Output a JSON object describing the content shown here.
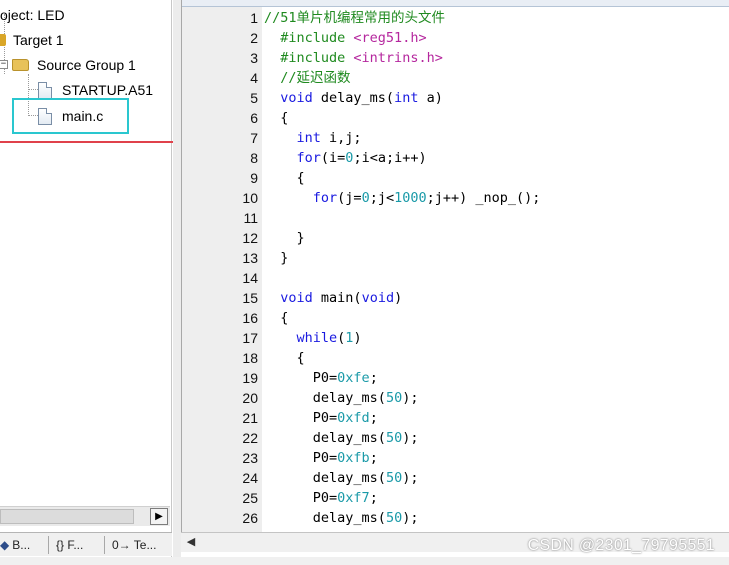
{
  "project_tree": {
    "project_label": "Project: LED",
    "target_label": "Target 1",
    "group_label": "Source Group 1",
    "files": [
      "STARTUP.A51",
      "main.c"
    ]
  },
  "left_tabs": [
    {
      "icon": "book-icon",
      "label": "B..."
    },
    {
      "icon": "braces-icon",
      "label": "{} F..."
    },
    {
      "icon": "template-icon",
      "label": "0→ Te..."
    }
  ],
  "scroll_arrows": {
    "right": "▶",
    "left": "◀"
  },
  "editor": {
    "lines": [
      {
        "n": "1",
        "indent": "",
        "tokens": [
          [
            "cm",
            "//51单片机编程常用的头文件"
          ]
        ]
      },
      {
        "n": "2",
        "indent": "  ",
        "tokens": [
          [
            "pp",
            "#include "
          ],
          [
            "str",
            "<reg51.h>"
          ]
        ]
      },
      {
        "n": "3",
        "indent": "  ",
        "tokens": [
          [
            "pp",
            "#include "
          ],
          [
            "str",
            "<intrins.h>"
          ]
        ]
      },
      {
        "n": "4",
        "indent": "  ",
        "tokens": [
          [
            "cm",
            "//延迟函数"
          ]
        ]
      },
      {
        "n": "5",
        "indent": "  ",
        "tokens": [
          [
            "kw",
            "void"
          ],
          [
            "p",
            " delay_ms("
          ],
          [
            "kw",
            "int"
          ],
          [
            "p",
            " a)"
          ]
        ]
      },
      {
        "n": "6",
        "indent": "  ",
        "tokens": [
          [
            "p",
            "{"
          ]
        ]
      },
      {
        "n": "7",
        "indent": "    ",
        "tokens": [
          [
            "kw",
            "int"
          ],
          [
            "p",
            " i,j;"
          ]
        ]
      },
      {
        "n": "8",
        "indent": "    ",
        "tokens": [
          [
            "kw",
            "for"
          ],
          [
            "p",
            "(i="
          ],
          [
            "num",
            "0"
          ],
          [
            "p",
            ";i<a;i++)"
          ]
        ]
      },
      {
        "n": "9",
        "indent": "    ",
        "tokens": [
          [
            "p",
            "{"
          ]
        ]
      },
      {
        "n": "10",
        "indent": "      ",
        "tokens": [
          [
            "kw",
            "for"
          ],
          [
            "p",
            "(j="
          ],
          [
            "num",
            "0"
          ],
          [
            "p",
            ";j<"
          ],
          [
            "num",
            "1000"
          ],
          [
            "p",
            ";j++) _nop_();"
          ]
        ]
      },
      {
        "n": "11",
        "indent": "",
        "tokens": []
      },
      {
        "n": "12",
        "indent": "    ",
        "tokens": [
          [
            "p",
            "}"
          ]
        ]
      },
      {
        "n": "13",
        "indent": "  ",
        "tokens": [
          [
            "p",
            "}"
          ]
        ]
      },
      {
        "n": "14",
        "indent": "",
        "tokens": []
      },
      {
        "n": "15",
        "indent": "  ",
        "tokens": [
          [
            "kw",
            "void"
          ],
          [
            "p",
            " main("
          ],
          [
            "kw",
            "void"
          ],
          [
            "p",
            ")"
          ]
        ]
      },
      {
        "n": "16",
        "indent": "  ",
        "tokens": [
          [
            "p",
            "{"
          ]
        ]
      },
      {
        "n": "17",
        "indent": "    ",
        "tokens": [
          [
            "kw",
            "while"
          ],
          [
            "p",
            "("
          ],
          [
            "num",
            "1"
          ],
          [
            "p",
            ")"
          ]
        ]
      },
      {
        "n": "18",
        "indent": "    ",
        "tokens": [
          [
            "p",
            "{"
          ]
        ]
      },
      {
        "n": "19",
        "indent": "      ",
        "tokens": [
          [
            "p",
            "P0="
          ],
          [
            "num",
            "0xfe"
          ],
          [
            "p",
            ";"
          ]
        ]
      },
      {
        "n": "20",
        "indent": "      ",
        "tokens": [
          [
            "p",
            "delay_ms("
          ],
          [
            "num",
            "50"
          ],
          [
            "p",
            ");"
          ]
        ]
      },
      {
        "n": "21",
        "indent": "      ",
        "tokens": [
          [
            "p",
            "P0="
          ],
          [
            "num",
            "0xfd"
          ],
          [
            "p",
            ";"
          ]
        ]
      },
      {
        "n": "22",
        "indent": "      ",
        "tokens": [
          [
            "p",
            "delay_ms("
          ],
          [
            "num",
            "50"
          ],
          [
            "p",
            ");"
          ]
        ]
      },
      {
        "n": "23",
        "indent": "      ",
        "tokens": [
          [
            "p",
            "P0="
          ],
          [
            "num",
            "0xfb"
          ],
          [
            "p",
            ";"
          ]
        ]
      },
      {
        "n": "24",
        "indent": "      ",
        "tokens": [
          [
            "p",
            "delay_ms("
          ],
          [
            "num",
            "50"
          ],
          [
            "p",
            ");"
          ]
        ]
      },
      {
        "n": "25",
        "indent": "      ",
        "tokens": [
          [
            "p",
            "P0="
          ],
          [
            "num",
            "0xf7"
          ],
          [
            "p",
            ";"
          ]
        ]
      },
      {
        "n": "26",
        "indent": "      ",
        "tokens": [
          [
            "p",
            "delay_ms("
          ],
          [
            "num",
            "50"
          ],
          [
            "p",
            ");"
          ]
        ]
      }
    ]
  },
  "watermark": "CSDN @2301_79795551",
  "colors": {
    "keyword": "#1a1ae0",
    "preprocessor": "#1f8a1f",
    "string": "#b5279e",
    "comment": "#1f8a1f",
    "number": "#1a9aa8",
    "highlight_red": "#e0414b",
    "highlight_cyan": "#2ac7cf"
  }
}
